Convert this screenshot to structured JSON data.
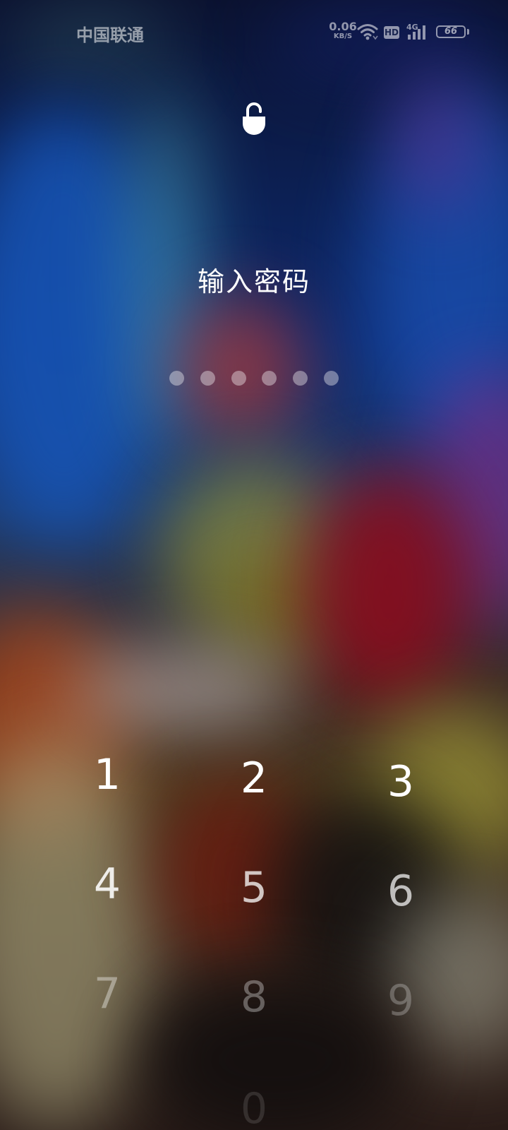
{
  "status_bar": {
    "carrier": "中国联通",
    "net_speed_value": "0.06",
    "net_speed_unit": "KB/S",
    "hd_label": "HD",
    "network_type": "4G",
    "battery_level": "66",
    "icons": [
      "wifi-icon",
      "hd-icon",
      "signal-icon",
      "battery-icon"
    ]
  },
  "lock": {
    "icon": "unlock-icon",
    "prompt": "输入密码",
    "pin_length": 6,
    "pin_entered": 0
  },
  "keypad": {
    "keys": [
      "1",
      "2",
      "3",
      "4",
      "5",
      "6",
      "7",
      "8",
      "9",
      "0"
    ]
  }
}
